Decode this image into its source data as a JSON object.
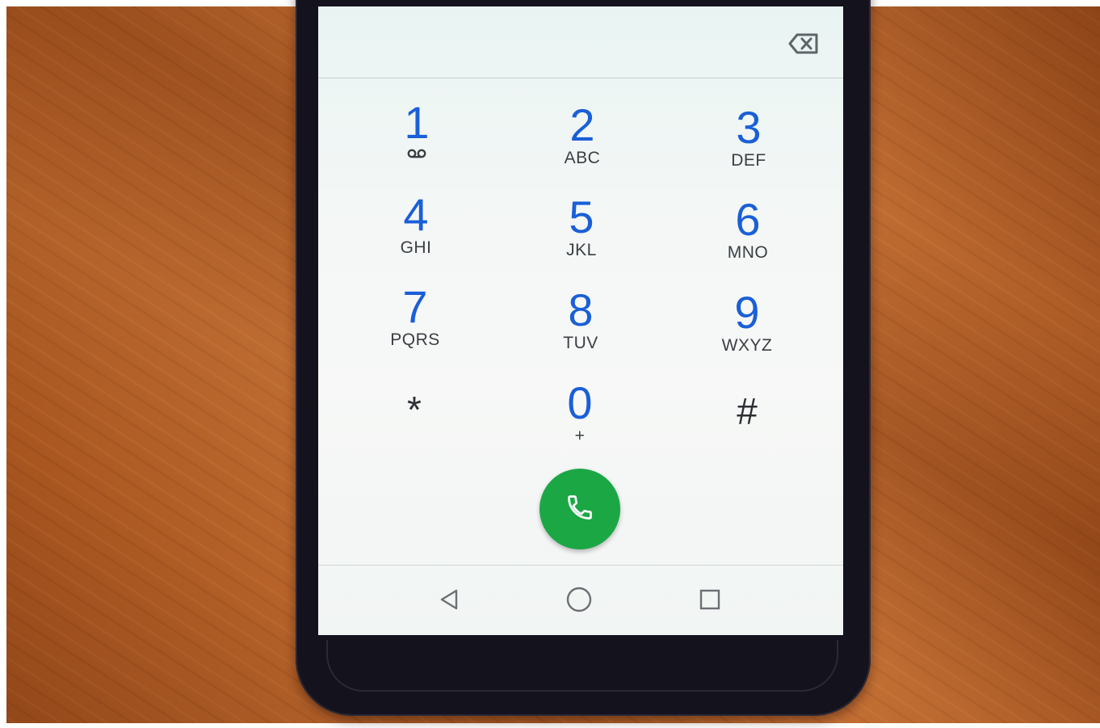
{
  "dialpad": {
    "keys": [
      {
        "digit": "1",
        "letters": "",
        "extra_icon": "voicemail-icon"
      },
      {
        "digit": "2",
        "letters": "ABC"
      },
      {
        "digit": "3",
        "letters": "DEF"
      },
      {
        "digit": "4",
        "letters": "GHI"
      },
      {
        "digit": "5",
        "letters": "JKL"
      },
      {
        "digit": "6",
        "letters": "MNO"
      },
      {
        "digit": "7",
        "letters": "PQRS"
      },
      {
        "digit": "8",
        "letters": "TUV"
      },
      {
        "digit": "9",
        "letters": "WXYZ"
      },
      {
        "symbol": "*"
      },
      {
        "digit": "0",
        "letters": "+"
      },
      {
        "symbol": "#"
      }
    ]
  },
  "icons": {
    "backspace": "backspace-icon",
    "call": "phone-icon",
    "nav_back": "back-triangle-icon",
    "nav_home": "home-circle-icon",
    "nav_recents": "recents-square-icon"
  },
  "colors": {
    "digit": "#1a5fd8",
    "call_button": "#1ca745",
    "letters": "#3b3f44"
  }
}
